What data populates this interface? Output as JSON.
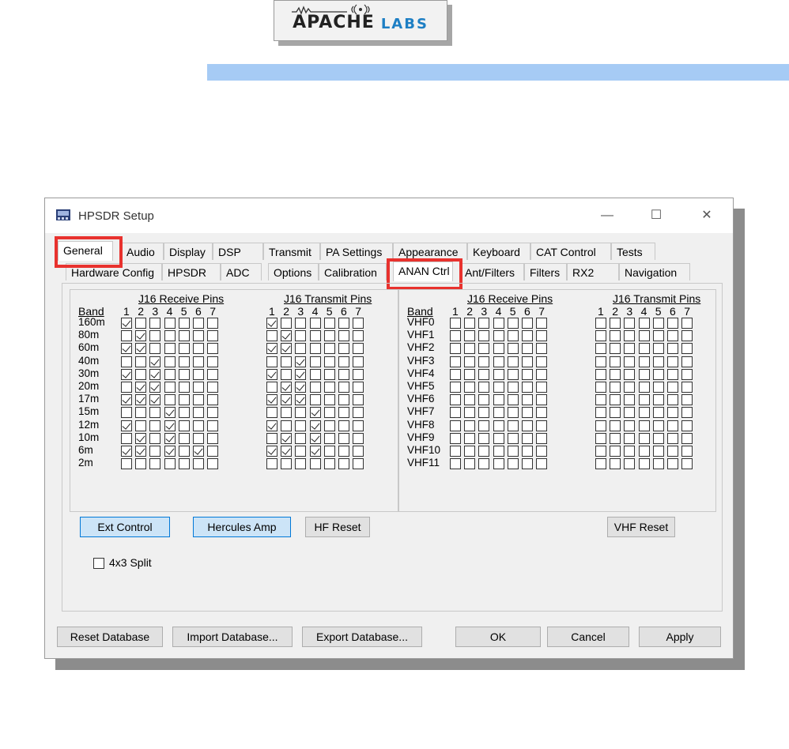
{
  "logo": {
    "apache": "APACHE",
    "labs": "LABS"
  },
  "window": {
    "title": "HPSDR Setup",
    "minimize": "—",
    "maximize": "☐",
    "close": "✕"
  },
  "tabs_row1": [
    "General",
    "Audio",
    "Display",
    "DSP",
    "Transmit",
    "PA Settings",
    "Appearance",
    "Keyboard",
    "CAT Control",
    "Tests"
  ],
  "tabs_row2": [
    "Hardware Config",
    "HPSDR",
    "ADC",
    "Options",
    "Calibration",
    "ANAN Ctrl",
    "Ant/Filters",
    "Filters",
    "RX2",
    "Navigation"
  ],
  "hf": {
    "receive_header": "J16 Receive Pins",
    "transmit_header": "J16 Transmit Pins",
    "band_header": "Band",
    "pins": [
      "1",
      "2",
      "3",
      "4",
      "5",
      "6",
      "7"
    ],
    "bands": [
      "160m",
      "80m",
      "60m",
      "40m",
      "30m",
      "20m",
      "17m",
      "15m",
      "12m",
      "10m",
      "6m",
      "2m"
    ],
    "receive": [
      [
        1,
        0,
        0,
        0,
        0,
        0,
        0
      ],
      [
        0,
        1,
        0,
        0,
        0,
        0,
        0
      ],
      [
        1,
        1,
        0,
        0,
        0,
        0,
        0
      ],
      [
        0,
        0,
        1,
        0,
        0,
        0,
        0
      ],
      [
        1,
        0,
        1,
        0,
        0,
        0,
        0
      ],
      [
        0,
        1,
        1,
        0,
        0,
        0,
        0
      ],
      [
        1,
        1,
        1,
        0,
        0,
        0,
        0
      ],
      [
        0,
        0,
        0,
        1,
        0,
        0,
        0
      ],
      [
        1,
        0,
        0,
        1,
        0,
        0,
        0
      ],
      [
        0,
        1,
        0,
        1,
        0,
        0,
        0
      ],
      [
        1,
        1,
        0,
        1,
        0,
        1,
        0
      ],
      [
        0,
        0,
        0,
        0,
        0,
        0,
        0
      ]
    ],
    "transmit": [
      [
        1,
        0,
        0,
        0,
        0,
        0,
        0
      ],
      [
        0,
        1,
        0,
        0,
        0,
        0,
        0
      ],
      [
        1,
        1,
        0,
        0,
        0,
        0,
        0
      ],
      [
        0,
        0,
        1,
        0,
        0,
        0,
        0
      ],
      [
        1,
        0,
        1,
        0,
        0,
        0,
        0
      ],
      [
        0,
        1,
        1,
        0,
        0,
        0,
        0
      ],
      [
        1,
        1,
        1,
        0,
        0,
        0,
        0
      ],
      [
        0,
        0,
        0,
        1,
        0,
        0,
        0
      ],
      [
        1,
        0,
        0,
        1,
        0,
        0,
        0
      ],
      [
        0,
        1,
        0,
        1,
        0,
        0,
        0
      ],
      [
        1,
        1,
        0,
        1,
        0,
        0,
        0
      ],
      [
        0,
        0,
        0,
        0,
        0,
        0,
        0
      ]
    ]
  },
  "vhf": {
    "receive_header": "J16 Receive Pins",
    "transmit_header": "J16 Transmit Pins",
    "band_header": "Band",
    "bands": [
      "VHF0",
      "VHF1",
      "VHF2",
      "VHF3",
      "VHF4",
      "VHF5",
      "VHF6",
      "VHF7",
      "VHF8",
      "VHF9",
      "VHF10",
      "VHF11"
    ]
  },
  "buttons": {
    "ext_control": "Ext Control",
    "hercules_amp": "Hercules Amp",
    "hf_reset": "HF Reset",
    "vhf_reset": "VHF Reset",
    "split_label": "4x3 Split",
    "reset_db": "Reset Database",
    "import_db": "Import Database...",
    "export_db": "Export Database...",
    "ok": "OK",
    "cancel": "Cancel",
    "apply": "Apply"
  },
  "colors": {
    "highlight": "#e8322e",
    "accent_blue": "#a6cbf5",
    "selected_button": "#cce4f7"
  }
}
